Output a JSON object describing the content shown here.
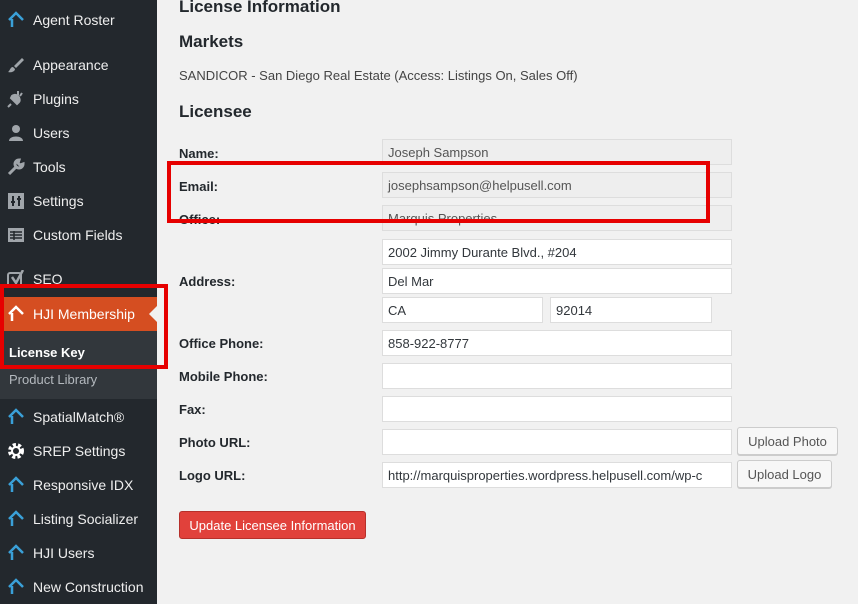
{
  "sidebar": {
    "items": [
      {
        "label": "Agent Roster",
        "icon": "hji-house-icon"
      },
      {
        "label": "Appearance",
        "icon": "paintbrush-icon"
      },
      {
        "label": "Plugins",
        "icon": "plug-icon"
      },
      {
        "label": "Users",
        "icon": "user-icon"
      },
      {
        "label": "Tools",
        "icon": "wrench-icon"
      },
      {
        "label": "Settings",
        "icon": "sliders-icon"
      },
      {
        "label": "Custom Fields",
        "icon": "table-icon"
      },
      {
        "label": "SEO",
        "icon": "yoast-icon"
      },
      {
        "label": "HJI Membership",
        "icon": "hji-house-icon"
      },
      {
        "label": "SpatialMatch®",
        "icon": "hji-house-icon"
      },
      {
        "label": "SREP Settings",
        "icon": "gear-icon"
      },
      {
        "label": "Responsive IDX",
        "icon": "hji-house-icon"
      },
      {
        "label": "Listing Socializer",
        "icon": "hji-house-icon"
      },
      {
        "label": "HJI Users",
        "icon": "hji-house-icon"
      },
      {
        "label": "New Construction",
        "icon": "hji-house-icon"
      }
    ],
    "submenu": [
      "License Key",
      "Product Library"
    ]
  },
  "content": {
    "license_title": "License Information",
    "markets_title": "Markets",
    "markets_text": "SANDICOR - San Diego Real Estate (Access: Listings On, Sales Off)",
    "licensee_title": "Licensee",
    "labels": {
      "name": "Name:",
      "email": "Email:",
      "office": "Office:",
      "address": "Address:",
      "office_phone": "Office Phone:",
      "mobile_phone": "Mobile Phone:",
      "fax": "Fax:",
      "photo_url": "Photo URL:",
      "logo_url": "Logo URL:"
    },
    "values": {
      "name": "Joseph Sampson",
      "email": "josephsampson@helpusell.com",
      "office": "Marquis Properties",
      "address1": "2002 Jimmy Durante Blvd., #204",
      "address2": "Del Mar",
      "state": "CA",
      "zip": "92014",
      "office_phone": "858-922-8777",
      "mobile_phone": "",
      "fax": "",
      "photo_url": "",
      "logo_url": "http://marquisproperties.wordpress.helpusell.com/wp-c"
    },
    "buttons": {
      "upload_photo": "Upload Photo",
      "upload_logo": "Upload Logo",
      "update": "Update Licensee Information"
    }
  },
  "colors": {
    "sidebar_bg": "#23282d",
    "active_item": "#d54e21",
    "primary_button": "#e1413b",
    "highlight_box": "#e60000"
  }
}
